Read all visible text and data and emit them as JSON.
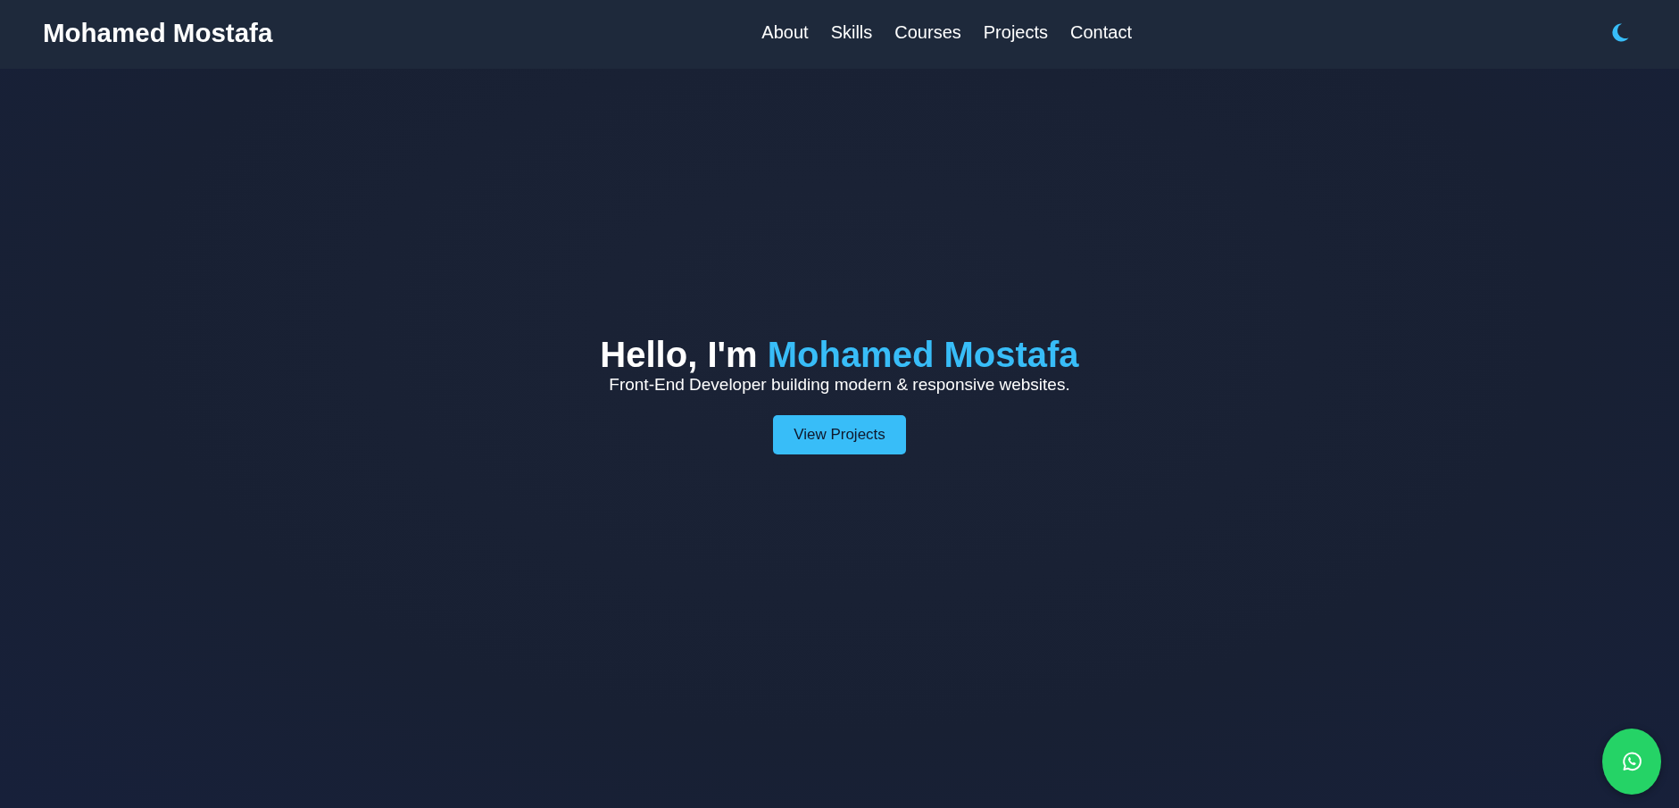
{
  "header": {
    "logo": "Mohamed Mostafa",
    "nav": [
      {
        "label": "About"
      },
      {
        "label": "Skills"
      },
      {
        "label": "Courses"
      },
      {
        "label": "Projects"
      },
      {
        "label": "Contact"
      }
    ]
  },
  "hero": {
    "greeting": "Hello, I'm",
    "name": "Mohamed Mostafa",
    "subtitle": "Front-End Developer building modern & responsive websites.",
    "button": "View Projects"
  }
}
